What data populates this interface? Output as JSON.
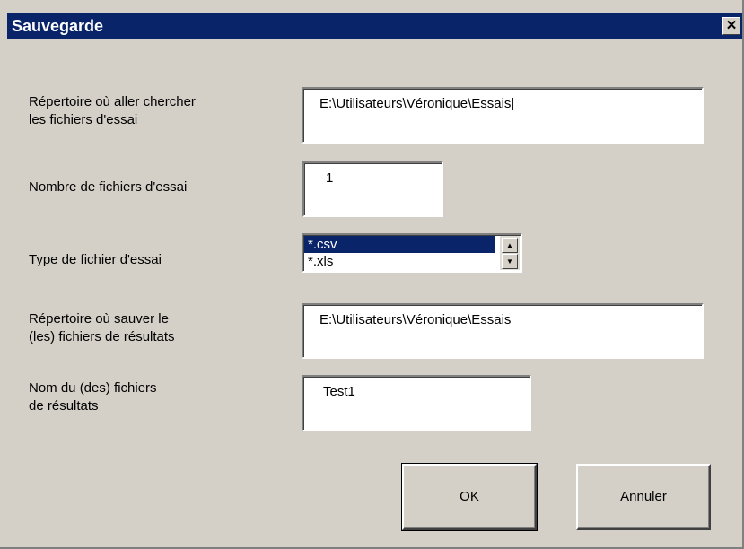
{
  "dialog": {
    "title": "Sauvegarde",
    "close_label": "✕"
  },
  "fields": {
    "search_dir": {
      "label": "Répertoire où aller chercher\nles fichiers d'essai",
      "value": "E:\\Utilisateurs\\Véronique\\Essais|"
    },
    "file_count": {
      "label": "Nombre de fichiers d'essai",
      "value": "1"
    },
    "file_type": {
      "label": "Type de fichier d'essai",
      "options": [
        "*.csv",
        "*.xls"
      ],
      "selected": "*.csv"
    },
    "save_dir": {
      "label": "Répertoire où sauver le\n(les) fichiers de résultats",
      "value": "E:\\Utilisateurs\\Véronique\\Essais"
    },
    "result_name": {
      "label": "Nom du (des) fichiers\nde résultats",
      "value": "Test1"
    }
  },
  "buttons": {
    "ok": "OK",
    "cancel": "Annuler"
  },
  "icons": {
    "close": "close-icon",
    "scroll_up": "scroll-up-arrow-icon",
    "scroll_down": "scroll-down-arrow-icon"
  },
  "colors": {
    "titlebar": "#0a246a",
    "dialog_bg": "#d4d0c8",
    "selection": "#0a246a"
  }
}
